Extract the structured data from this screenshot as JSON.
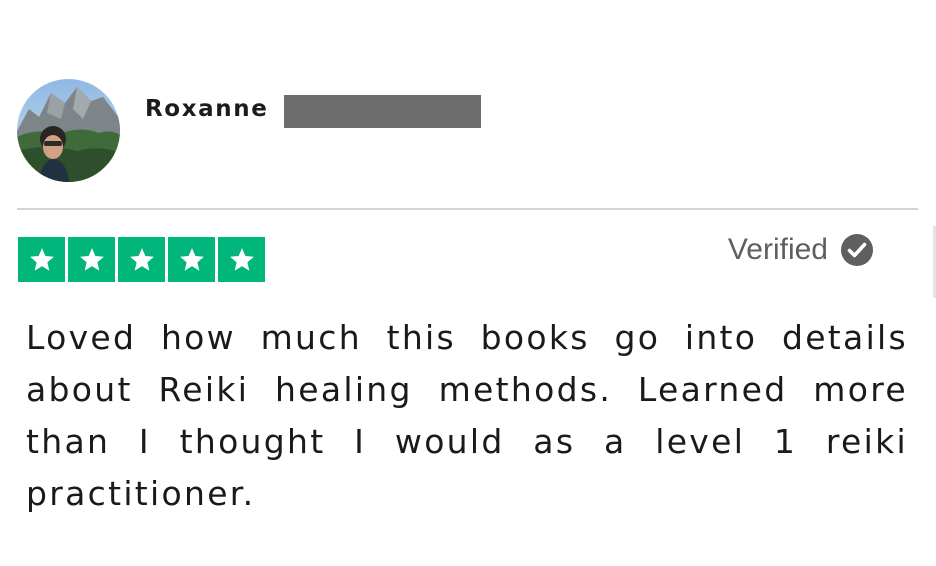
{
  "review": {
    "reviewer": {
      "name": "Roxanne",
      "surname_redacted": true
    },
    "rating": {
      "stars": 5,
      "max_stars": 5,
      "star_color": "#00b67a"
    },
    "verified_label": "Verified",
    "body": "Loved how much this books go into details about Reiki healing methods. Learned more than I thought I would as a level 1 reiki practitioner."
  },
  "icons": {
    "avatar": "profile-photo",
    "star": "star-icon",
    "verified": "checkmark-circle-icon"
  }
}
